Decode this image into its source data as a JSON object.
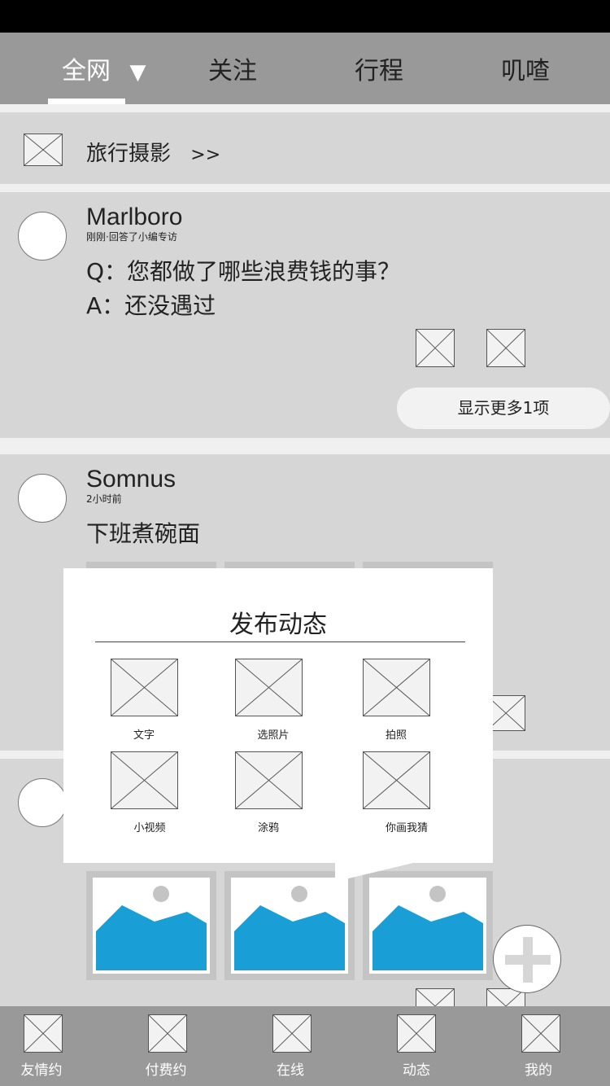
{
  "top_nav": {
    "tabs": [
      {
        "label": "全网",
        "dropdown_arrow": "▼"
      },
      {
        "label": "关注"
      },
      {
        "label": "行程"
      },
      {
        "label": "叽喳"
      }
    ]
  },
  "category": {
    "label": "旅行摄影",
    "arrow": ">>"
  },
  "posts": [
    {
      "username": "Marlboro",
      "meta": "刚刚·回答了小编专访",
      "question": "Q：您都做了哪些浪费钱的事？",
      "answer": "A：还没遇过",
      "more_label": "显示更多1项"
    },
    {
      "username": "Somnus",
      "meta": "2小时前",
      "text": "下班煮碗面"
    }
  ],
  "popup": {
    "title": "发布动态",
    "options": [
      {
        "label": "文字",
        "icon": "image-placeholder-icon"
      },
      {
        "label": "选照片",
        "icon": "image-placeholder-icon"
      },
      {
        "label": "拍照",
        "icon": "image-placeholder-icon"
      },
      {
        "label": "小视频",
        "icon": "image-placeholder-icon"
      },
      {
        "label": "涂鸦",
        "icon": "image-placeholder-icon"
      },
      {
        "label": "你画我猜",
        "icon": "image-placeholder-icon"
      }
    ]
  },
  "fab": {
    "icon": "plus-icon"
  },
  "bottom_nav": {
    "items": [
      {
        "label": "友情约",
        "icon": "image-placeholder-icon"
      },
      {
        "label": "付费约",
        "icon": "image-placeholder-icon"
      },
      {
        "label": "在线",
        "icon": "image-placeholder-icon"
      },
      {
        "label": "动态",
        "icon": "image-placeholder-icon"
      },
      {
        "label": "我的",
        "icon": "image-placeholder-icon"
      }
    ]
  },
  "colors": {
    "top_bar": "#999999",
    "card_bg": "#d6d6d6",
    "photo_sky": "#1a9ed6",
    "white": "#ffffff"
  }
}
